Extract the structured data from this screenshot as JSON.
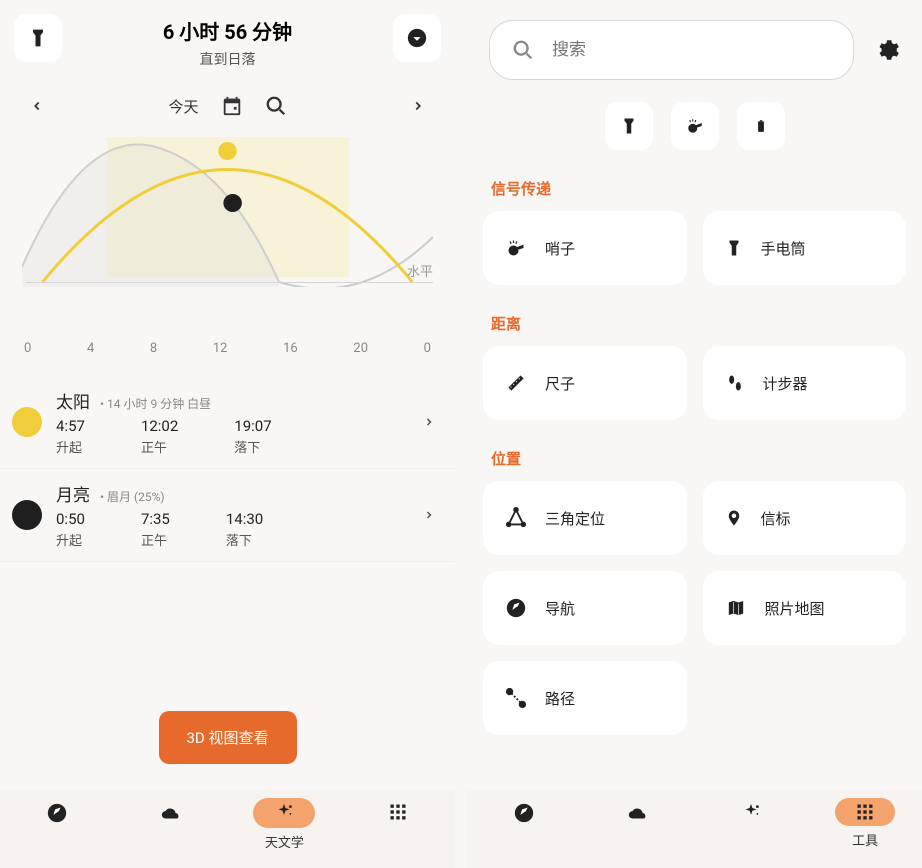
{
  "left": {
    "title": "6 小时 56 分钟",
    "subtitle": "直到日落",
    "today": "今天",
    "horizon": "水平",
    "xaxis": [
      "0",
      "4",
      "8",
      "12",
      "16",
      "20",
      "0"
    ],
    "sun": {
      "name": "太阳",
      "meta": "• 14 小时 9 分钟 白昼",
      "rise": {
        "v": "4:57",
        "l": "升起"
      },
      "noon": {
        "v": "12:02",
        "l": "正午"
      },
      "set": {
        "v": "19:07",
        "l": "落下"
      }
    },
    "moon": {
      "name": "月亮",
      "meta": "• 眉月 (25%)",
      "rise": {
        "v": "0:50",
        "l": "升起"
      },
      "noon": {
        "v": "7:35",
        "l": "正午"
      },
      "set": {
        "v": "14:30",
        "l": "落下"
      }
    },
    "button3d": "3D 视图查看",
    "nav_astronomy": "天文学"
  },
  "right": {
    "search_placeholder": "搜索",
    "sec_signal": "信号传递",
    "sec_distance": "距离",
    "sec_location": "位置",
    "tools": {
      "whistle": "哨子",
      "flashlight": "手电筒",
      "ruler": "尺子",
      "pedometer": "计步器",
      "triangulate": "三角定位",
      "beacon": "信标",
      "navigate": "导航",
      "photomap": "照片地图",
      "path": "路径"
    },
    "nav_tools": "工具"
  },
  "chart_data": {
    "type": "line",
    "title": "",
    "xlabel": "",
    "ylabel": "",
    "x": [
      0,
      4,
      8,
      12,
      16,
      20,
      24
    ],
    "xlim": [
      0,
      24
    ],
    "ylim": [
      -1,
      1
    ],
    "series": [
      {
        "name": "sun_altitude",
        "color": "#f0ce3b",
        "values": [
          -0.9,
          -0.3,
          0.55,
          0.98,
          0.55,
          -0.35,
          -0.9
        ]
      },
      {
        "name": "moon_altitude",
        "color": "#bbbbbb",
        "values": [
          -0.1,
          0.6,
          0.95,
          0.5,
          -0.5,
          -0.95,
          -0.5
        ]
      }
    ],
    "markers": [
      {
        "series": "sun_altitude",
        "x": 12,
        "y": 0.98,
        "color": "#f0ce3b"
      },
      {
        "series": "moon_altitude",
        "x": 12.2,
        "y": 0.48,
        "color": "#1f1f1f",
        "label": "current"
      }
    ]
  }
}
